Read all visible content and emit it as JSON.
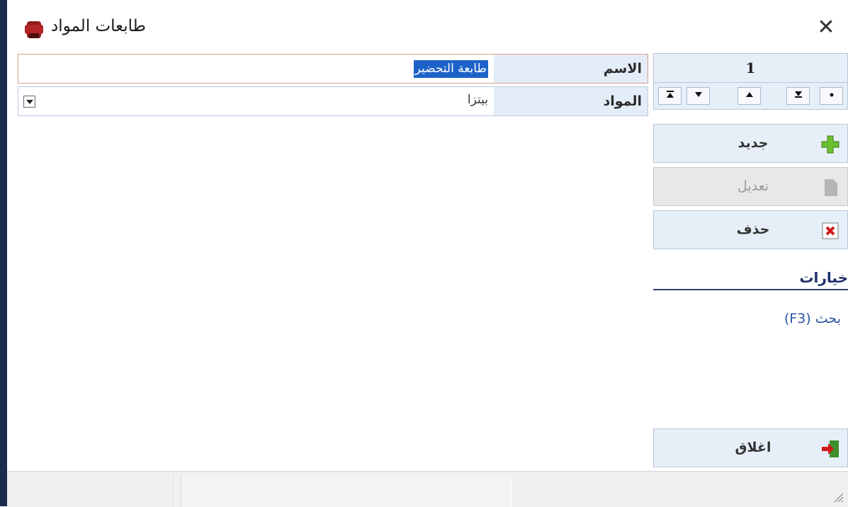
{
  "window": {
    "title": "طابعات المواد",
    "close_icon": "close-icon",
    "app_icon": "printer-icon"
  },
  "form": {
    "name_label": "الاسم",
    "name_value": "طابعة التحضير",
    "materials_label": "المواد",
    "materials_value": "بيتزا"
  },
  "panel": {
    "record_number": "1",
    "nav_icons": [
      "last-record-icon",
      "next-record-icon",
      "previous-record-icon",
      "first-record-icon",
      "current-record-icon"
    ],
    "new_label": "جديد",
    "edit_label": "تعديل",
    "delete_label": "حذف",
    "close_label": "اغلاق",
    "options_title": "خيارات",
    "search_link": "بحث  (F3)"
  },
  "colors": {
    "accent": "#1c62c8",
    "panel_bg": "#e6eef7",
    "label_bg": "#e3edf7",
    "frame": "#1d2b4f"
  }
}
